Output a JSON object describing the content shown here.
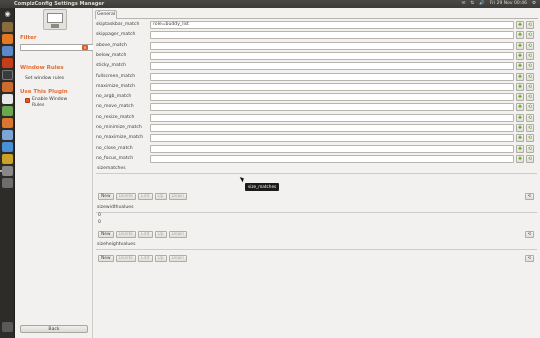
{
  "window": {
    "title": "CompizConfig Settings Manager"
  },
  "top_panel": {
    "indicators": [
      "✉",
      "⇅",
      "🔊",
      "Fri 29 Nov 00:46",
      "⚙"
    ]
  },
  "launcher": {
    "icons": [
      "dash",
      "files",
      "browser",
      "software-center",
      "settings",
      "terminal",
      "media",
      "writer",
      "calc",
      "impress",
      "chat",
      "photos",
      "workspace",
      "trash"
    ]
  },
  "sidebar": {
    "filter_label": "Filter",
    "filter_value": "",
    "window_rules_heading": "Window Rules",
    "set_window_rules": "Set window rules",
    "use_this_plugin_heading": "Use This Plugin",
    "enable_label": "Enable Window Rules",
    "back_label": "Back"
  },
  "main": {
    "tab_label": "General",
    "rows": [
      {
        "label": "skiptaskbar_match",
        "value": "role=buddy_list"
      },
      {
        "label": "skippager_match",
        "value": ""
      },
      {
        "label": "above_match",
        "value": ""
      },
      {
        "label": "below_match",
        "value": ""
      },
      {
        "label": "sticky_match",
        "value": ""
      },
      {
        "label": "fullscreen_match",
        "value": ""
      },
      {
        "label": "maximize_match",
        "value": ""
      },
      {
        "label": "no_argb_match",
        "value": ""
      },
      {
        "label": "no_move_match",
        "value": ""
      },
      {
        "label": "no_resize_match",
        "value": ""
      },
      {
        "label": "no_minimize_match",
        "value": ""
      },
      {
        "label": "no_maximize_match",
        "value": ""
      },
      {
        "label": "no_close_match",
        "value": ""
      },
      {
        "label": "no_focus_match",
        "value": ""
      }
    ],
    "size_matches": {
      "label": "sizematches"
    },
    "size_width_values": {
      "label": "sizewidthvalues",
      "values": [
        "0",
        "0"
      ]
    },
    "size_height_values": {
      "label": "sizeheightvalues"
    },
    "buttons": {
      "new": "New",
      "delete": "Delete",
      "edit": "Edit",
      "up": "Up",
      "down": "Down"
    },
    "tooltip": "size_matches"
  }
}
